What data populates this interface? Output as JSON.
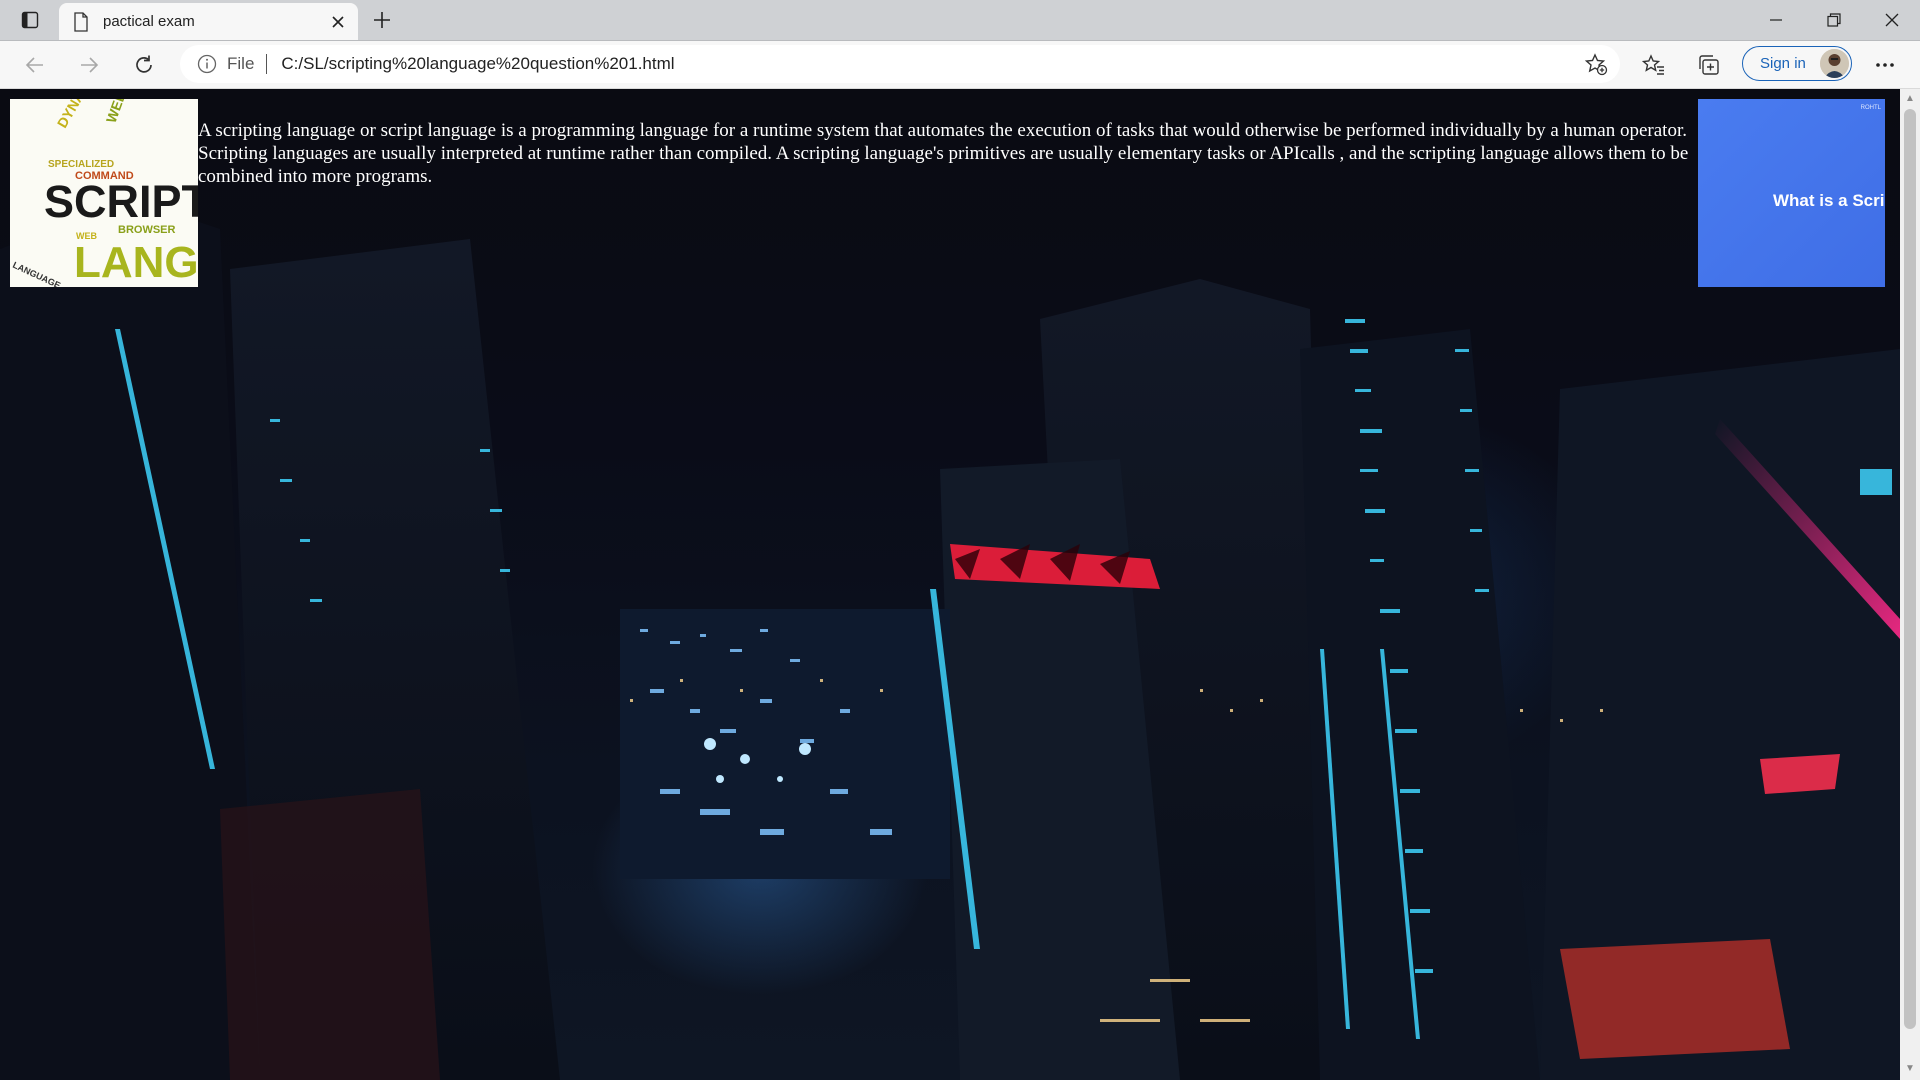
{
  "browser": {
    "tab": {
      "title": "pactical exam"
    },
    "address": {
      "prefix": "File",
      "url": "C:/SL/scripting%20language%20question%201.html"
    },
    "signin_label": "Sign in"
  },
  "page": {
    "left_image_words": [
      "SCRIPT",
      "LANGU",
      "SPECIALIZED",
      "COMMAND",
      "DYNAMIC",
      "BROWSER",
      "WEB",
      "LANGUAGE"
    ],
    "right_image": {
      "title": "What is a Scri",
      "tag": "ROHTL"
    },
    "paragraph": "A scripting language or script language is a programming language for a runtime system that automates the execution of tasks that would otherwise be performed individually by a human operator. Scripting languages are usually interpreted at runtime rather than compiled. A scripting language's primitives are usually elementary tasks or APIcalls , and the scripting language allows them to be combined into more programs."
  },
  "colors": {
    "accent": "#1a63b8",
    "background_scene": "#0a0c18",
    "right_image_bg": "#4a7cf0",
    "neon_red": "#ff1e3c",
    "neon_cyan": "#3cc8f0"
  }
}
